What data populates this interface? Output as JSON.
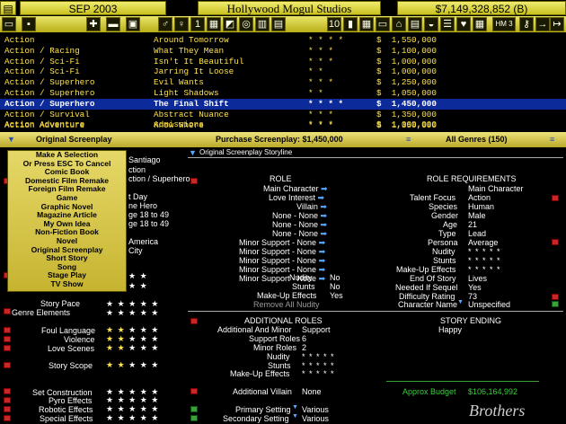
{
  "top": {
    "date": "SEP 2003",
    "studio": "Hollywood Mogul Studios",
    "money": "$7,149,328,852 (B)",
    "hm": "HM 3"
  },
  "list": [
    {
      "genre": "Action",
      "title": "Around Tomorrow",
      "stars": "* * * *",
      "price": "$  1,550,000"
    },
    {
      "genre": "Action / Racing",
      "title": "What They Mean",
      "stars": "* * *",
      "price": "$  1,100,000"
    },
    {
      "genre": "Action / Sci-Fi",
      "title": "Isn't It Beautiful",
      "stars": "* * *",
      "price": "$  1,000,000"
    },
    {
      "genre": "Action / Sci-Fi",
      "title": "Jarring It Loose",
      "stars": "* *",
      "price": "$  1,000,000"
    },
    {
      "genre": "Action / Superhero",
      "title": "Evil Wants",
      "stars": "* * *",
      "price": "$  1,250,000"
    },
    {
      "genre": "Action / Superhero",
      "title": "Light Shadows",
      "stars": "* *",
      "price": "$  1,050,000"
    },
    {
      "genre": "Action / Superhero",
      "title": "The Final Shift",
      "stars": "* * * *",
      "price": "$  1,450,000"
    },
    {
      "genre": "Action / Survival",
      "title": "Abstract Nuance",
      "stars": "* * *",
      "price": "$  1,350,000"
    },
    {
      "genre": "Action Adventure",
      "title": "Admissions",
      "stars": "* * *",
      "price": "$  1,000,000"
    },
    {
      "genre": "Action Adventure",
      "title": "Know Where",
      "stars": "* * *",
      "price": "$  1,350,000"
    }
  ],
  "gbar": {
    "left": "Original Screenplay",
    "mid": "Purchase Screenplay: $1,450,000",
    "right": "All Genres (150)"
  },
  "popup": [
    "Make A Selection",
    "Or Press ESC To Cancel",
    "Comic Book",
    "Domestic Film Remake",
    "Foreign Film Remake",
    "Game",
    "Graphic Novel",
    "Magazine Article",
    "My Own Idea",
    "Non-Fiction Book",
    "Novel",
    "Original Screenplay",
    "Short Story",
    "Song",
    "Stage Play",
    "TV Show"
  ],
  "behind": {
    "l1": "Santiago",
    "l2": "ction",
    "l3": "ction / Superhero",
    "l4": "t Day",
    "l5": "ne Hero",
    "l6": "ge 18 to 49",
    "l7": "ge 18 to 49",
    "l8": "America",
    "l9": "City",
    "story_pace": "Story Pace",
    "genre_elements": "Genre Elements"
  },
  "storyline": "Original Screenplay Storyline",
  "role": {
    "head": "ROLE",
    "items": [
      "Main Character",
      "Love Interest",
      "Villain",
      "None - None",
      "None - None",
      "None - None",
      "Minor Support - None",
      "Minor Support - None",
      "Minor Support - None",
      "Minor Support - None",
      "Minor Support - None"
    ],
    "nudity_l": "Nudity",
    "nudity_v": "No",
    "stunts_l": "Stunts",
    "stunts_v": "No",
    "mue_l": "Make-Up Effects",
    "mue_v": "Yes",
    "remove": "Remove All Nudity"
  },
  "req": {
    "head": "ROLE REQUIREMENTS",
    "first": "Main Character",
    "labels": [
      "Talent Focus",
      "Species",
      "Gender",
      "Age",
      "Type",
      "Persona",
      "Nudity",
      "Stunts",
      "Make-Up Effects",
      "End Of Story",
      "Needed If Sequel",
      "Difficulty Rating",
      "Character Name"
    ],
    "values": [
      "Action",
      "Human",
      "Male",
      "21",
      "Lead",
      "Average",
      "* * * * *",
      "* * * * *",
      "* * * * *",
      "Lives",
      "Yes",
      "73",
      "Unspecified"
    ]
  },
  "additional": {
    "head": "ADDITIONAL ROLES",
    "labels": [
      "Additional And Minor",
      "Support Roles",
      "Minor Roles",
      "Nudity",
      "Stunts",
      "Make-Up Effects"
    ],
    "values": [
      "Support",
      "6",
      "2",
      "* * * * *",
      "* * * * *",
      "* * * * *"
    ],
    "villain_l": "Additional Villain",
    "villain_v": "None",
    "primary_l": "Primary Setting",
    "primary_v": "Various",
    "secondary_l": "Secondary Setting",
    "secondary_v": "Various"
  },
  "ending": {
    "head": "STORY ENDING",
    "value": "Happy"
  },
  "budget": {
    "label": "Approx Budget",
    "value": "$106,164,992"
  },
  "left": {
    "foul": "Foul Language",
    "violence": "Violence",
    "love": "Love Scenes",
    "scope": "Story Scope",
    "setcon": "Set Construction",
    "pyro": "Pyro Effects",
    "robotic": "Robotic Effects",
    "special": "Special Effects"
  },
  "watermark": "Brothers"
}
